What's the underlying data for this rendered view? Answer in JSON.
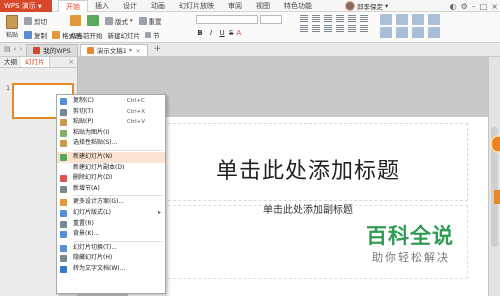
{
  "app": {
    "wps_label": "WPS 演示",
    "tabs": [
      "开始",
      "插入",
      "设计",
      "动画",
      "幻灯片放映",
      "审阅",
      "视图",
      "特色功能"
    ],
    "active_tab": "开始",
    "user_name": "邱李保定"
  },
  "ribbon": {
    "paste": "粘贴",
    "cut": "剪切",
    "copy": "复制",
    "format_painter": "格式刷",
    "from_current": "从当前开始",
    "new_slide": "新建幻灯片",
    "layout": "版式",
    "section": "节",
    "reset": "重置"
  },
  "docbar": {
    "tabs": [
      {
        "label": "我的WPS",
        "icon": "wps-home-icon",
        "color": "#d9472b"
      },
      {
        "label": "演示文稿1 *",
        "icon": "presentation-icon",
        "color": "#e98a2a"
      }
    ],
    "add": "+"
  },
  "left_panel": {
    "tabs": [
      "大纲",
      "幻灯片"
    ],
    "active": "幻灯片",
    "close": "×",
    "slide_number": "1"
  },
  "slide": {
    "title": "单击此处添加标题",
    "subtitle": "单击此处添加副标题"
  },
  "context_menu": {
    "items": [
      {
        "label": "复制(C)",
        "shortcut": "Ctrl+C",
        "icon": "copy-icon"
      },
      {
        "label": "剪切(T)",
        "shortcut": "Ctrl+X",
        "icon": "cut-icon"
      },
      {
        "label": "粘贴(P)",
        "shortcut": "Ctrl+V",
        "icon": "paste-icon"
      },
      {
        "label": "粘贴为图片(I)",
        "shortcut": "",
        "icon": "paste-image-icon"
      },
      {
        "label": "选择性粘贴(S)...",
        "shortcut": "",
        "icon": "paste-special-icon"
      },
      {
        "label": "新建幻灯片(N)",
        "shortcut": "",
        "icon": "new-slide-icon"
      },
      {
        "label": "新建幻灯片副本(D)",
        "shortcut": "",
        "icon": ""
      },
      {
        "label": "删除幻灯片(D)",
        "shortcut": "",
        "icon": "delete-slide-icon"
      },
      {
        "label": "新增节(A)",
        "shortcut": "",
        "icon": "add-section-icon"
      },
      {
        "label": "更多设计方案(G)...",
        "shortcut": "",
        "icon": "design-icon"
      },
      {
        "label": "幻灯片版式(L)",
        "shortcut": "",
        "icon": "layout-icon",
        "submenu": true
      },
      {
        "label": "重置(R)",
        "shortcut": "",
        "icon": "reset-icon"
      },
      {
        "label": "背景(K)...",
        "shortcut": "",
        "icon": "background-icon"
      },
      {
        "label": "幻灯片切换(T)...",
        "shortcut": "",
        "icon": "transition-icon"
      },
      {
        "label": "隐藏幻灯片(H)",
        "shortcut": "",
        "icon": "hide-slide-icon"
      },
      {
        "label": "转为文字文档(W)...",
        "shortcut": "",
        "icon": "to-doc-icon"
      }
    ],
    "highlighted_index": 5
  },
  "watermark": {
    "title": "百科全说",
    "subtitle": "助你轻松解决"
  },
  "colors": {
    "accent": "#d9472b",
    "highlight": "#fbe3cf",
    "watermark_green": "#2f9c55",
    "selection_orange": "#e58a2a"
  }
}
